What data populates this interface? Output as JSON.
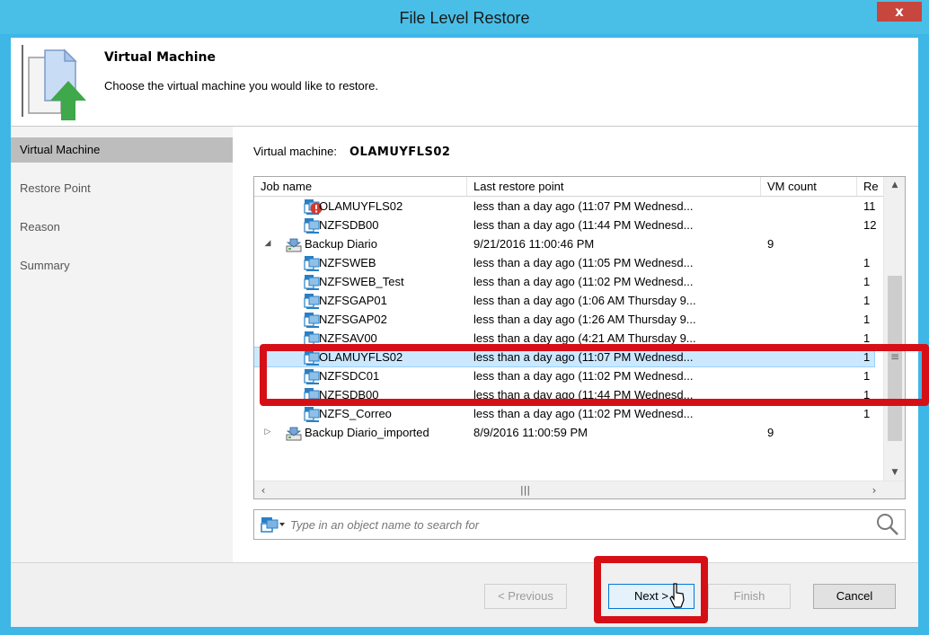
{
  "window": {
    "title": "File Level Restore",
    "close_label": "x"
  },
  "header": {
    "title": "Virtual Machine",
    "description": "Choose the virtual machine you would like to restore."
  },
  "sidebar": {
    "items": [
      {
        "label": "Virtual Machine",
        "active": true
      },
      {
        "label": "Restore Point",
        "active": false
      },
      {
        "label": "Reason",
        "active": false
      },
      {
        "label": "Summary",
        "active": false
      }
    ]
  },
  "vm": {
    "label": "Virtual machine:",
    "name": "OLAMUYFLS02"
  },
  "grid": {
    "columns": [
      "Job name",
      "Last restore point",
      "VM count",
      "Re"
    ],
    "rows": [
      {
        "name": "OLAMUYFLS02",
        "restore": "less than a day ago (11:07 PM Wednesd...",
        "count": "",
        "re": "11",
        "kind": "vm-error"
      },
      {
        "name": "NZFSDB00",
        "restore": "less than a day ago (11:44 PM Wednesd...",
        "count": "",
        "re": "12",
        "kind": "vm"
      },
      {
        "name": "Backup Diario",
        "restore": "9/21/2016 11:00:46 PM",
        "count": "9",
        "re": "",
        "kind": "job-expanded"
      },
      {
        "name": "NZFSWEB",
        "restore": "less than a day ago (11:05 PM Wednesd...",
        "count": "",
        "re": "1",
        "kind": "vm"
      },
      {
        "name": "NZFSWEB_Test",
        "restore": "less than a day ago (11:02 PM Wednesd...",
        "count": "",
        "re": "1",
        "kind": "vm"
      },
      {
        "name": "NZFSGAP01",
        "restore": "less than a day ago (1:06 AM Thursday 9...",
        "count": "",
        "re": "1",
        "kind": "vm"
      },
      {
        "name": "NZFSGAP02",
        "restore": "less than a day ago (1:26 AM Thursday 9...",
        "count": "",
        "re": "1",
        "kind": "vm"
      },
      {
        "name": "NZFSAV00",
        "restore": "less than a day ago (4:21 AM Thursday 9...",
        "count": "",
        "re": "1",
        "kind": "vm"
      },
      {
        "name": "OLAMUYFLS02",
        "restore": "less than a day ago (11:07 PM Wednesd...",
        "count": "",
        "re": "1",
        "kind": "vm",
        "selected": true
      },
      {
        "name": "NZFSDC01",
        "restore": "less than a day ago (11:02 PM Wednesd...",
        "count": "",
        "re": "1",
        "kind": "vm"
      },
      {
        "name": "NZFSDB00",
        "restore": "less than a day ago (11:44 PM Wednesd...",
        "count": "",
        "re": "1",
        "kind": "vm"
      },
      {
        "name": "NZFS_Correo",
        "restore": "less than a day ago (11:02 PM Wednesd...",
        "count": "",
        "re": "1",
        "kind": "vm"
      },
      {
        "name": "Backup Diario_imported",
        "restore": "8/9/2016 11:00:59 PM",
        "count": "9",
        "re": "",
        "kind": "job-collapsed"
      }
    ]
  },
  "search": {
    "placeholder": "Type in an object name to search for"
  },
  "buttons": {
    "previous": "< Previous",
    "next": "Next >",
    "finish": "Finish",
    "cancel": "Cancel"
  },
  "icons": {
    "vm": "vm-icon",
    "job": "backup-job-icon",
    "error": "error-icon",
    "search": "search-icon",
    "close": "close-icon",
    "header": "file-restore-icon"
  },
  "colors": {
    "titlebar": "#49bfe8",
    "selection": "#cce8ff",
    "highlight": "#d60f17",
    "close": "#c7463e"
  }
}
